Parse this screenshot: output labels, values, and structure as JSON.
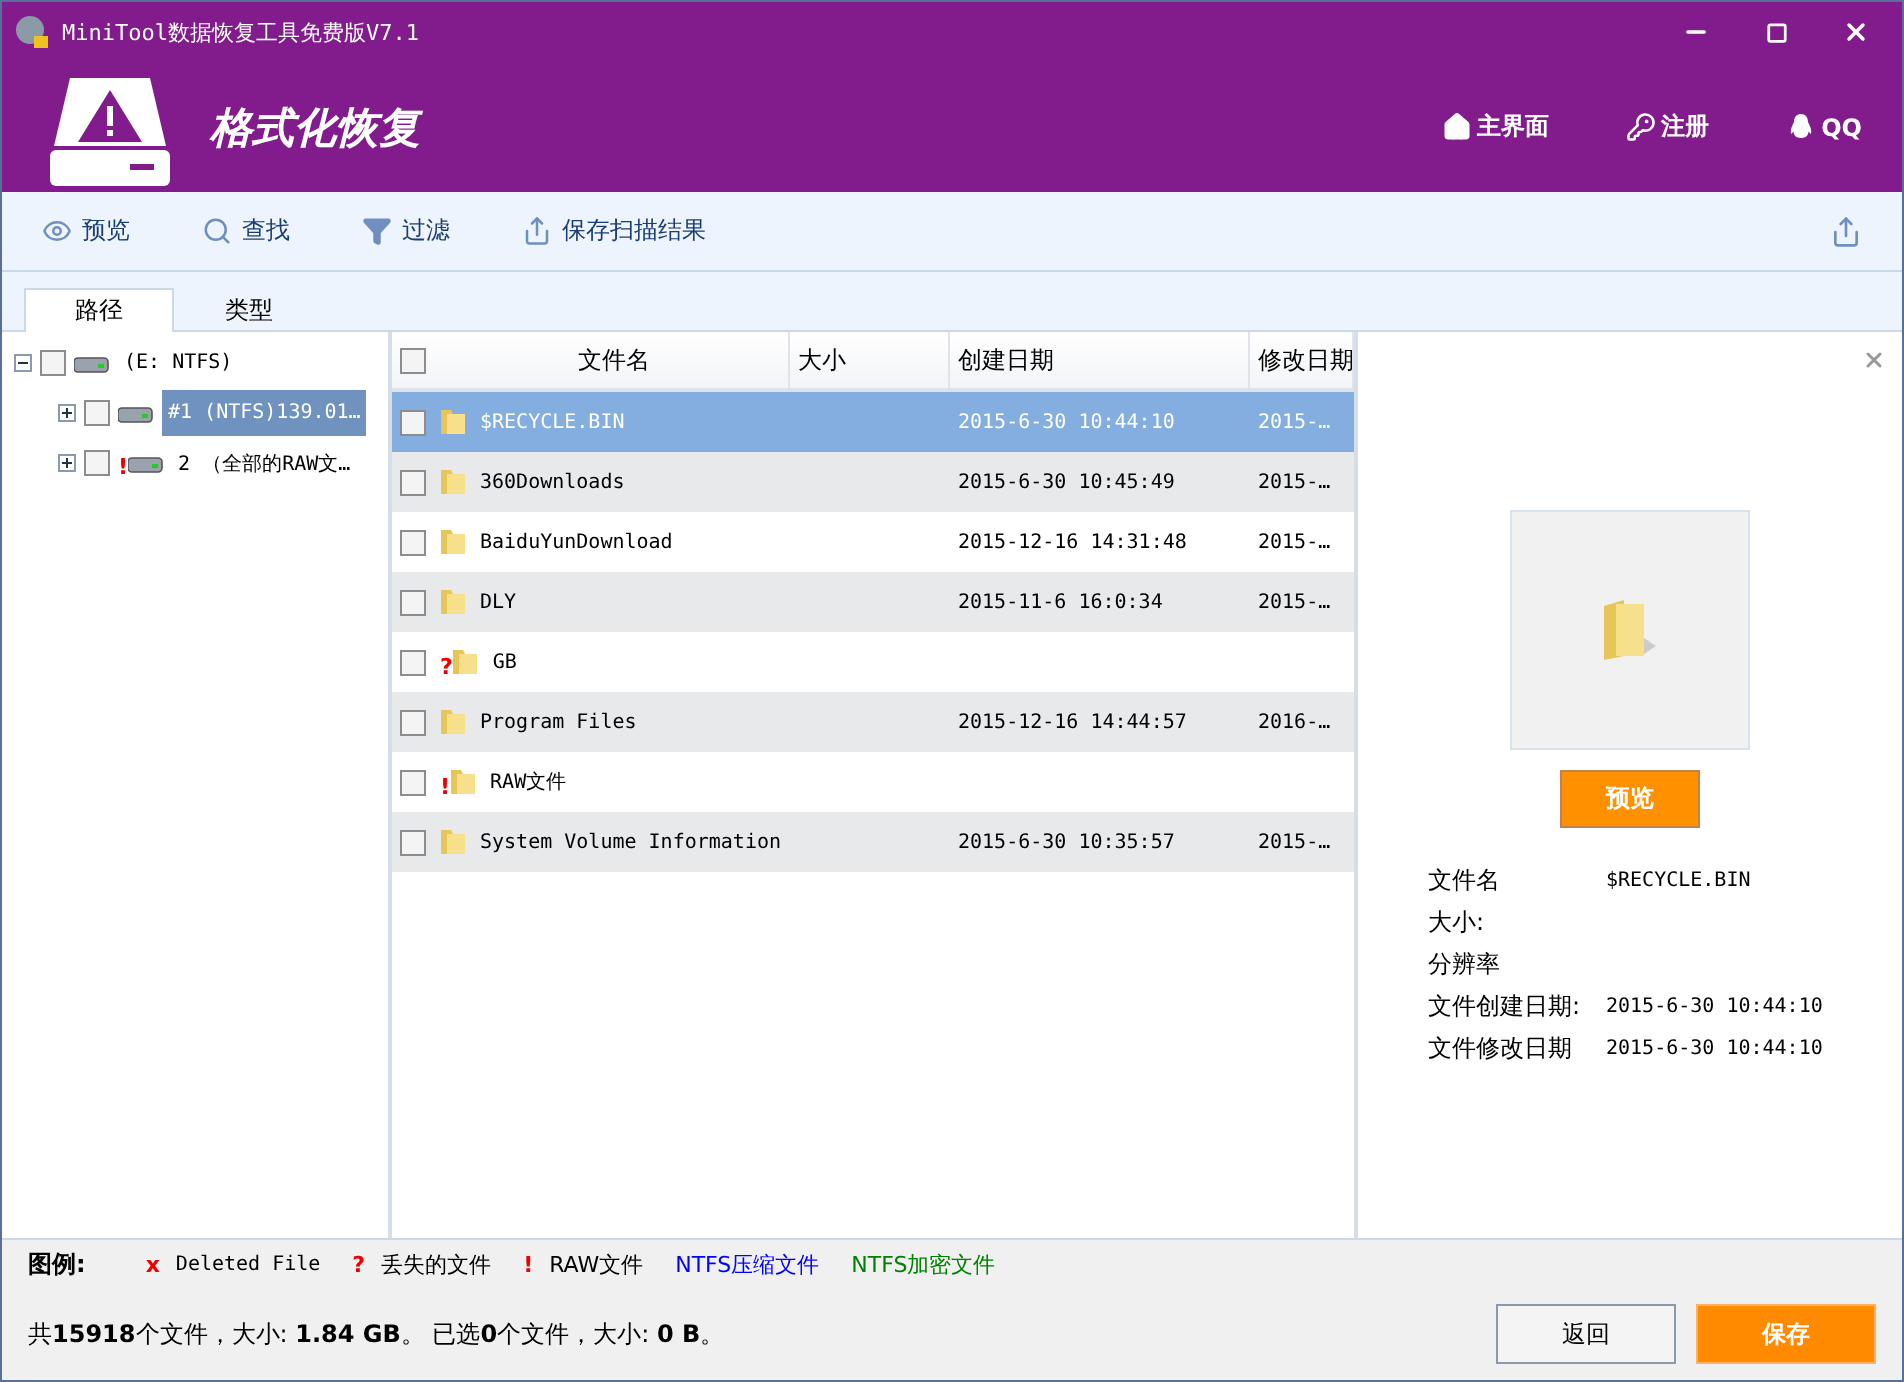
{
  "window": {
    "title": "MiniTool数据恢复工具免费版V7.1"
  },
  "header": {
    "title": "格式化恢复",
    "nav": [
      {
        "label": "主界面",
        "kind": "home"
      },
      {
        "label": "注册",
        "kind": "key"
      },
      {
        "label": "QQ",
        "kind": "qq"
      }
    ]
  },
  "toolbar": {
    "items": [
      {
        "label": "预览",
        "kind": "eye"
      },
      {
        "label": "查找",
        "kind": "search"
      },
      {
        "label": "过滤",
        "kind": "filter"
      },
      {
        "label": "保存扫描结果",
        "kind": "export"
      }
    ]
  },
  "tabs": [
    {
      "label": "路径",
      "selected": true
    },
    {
      "label": "类型",
      "selected": false
    }
  ],
  "tree": [
    {
      "label": "(E: NTFS)",
      "checked": false,
      "expanded": true,
      "selected": false,
      "children": [
        {
          "label": "#1 (NTFS)139.01…",
          "checked": false,
          "expanded": false,
          "selected": true
        },
        {
          "label": "2 （全部的RAW文…",
          "checked": false,
          "expanded": false,
          "selected": false,
          "mark": "!"
        }
      ]
    }
  ],
  "table": {
    "select_all_checked": false,
    "columns": [
      "文件名",
      "大小",
      "创建日期",
      "修改日期"
    ],
    "rows": [
      {
        "name": "$RECYCLE.BIN",
        "created": "2015-6-30 10:44:10",
        "modified": "2015-…",
        "checked": false,
        "selected": true
      },
      {
        "name": "360Downloads",
        "created": "2015-6-30 10:45:49",
        "modified": "2015-…",
        "checked": false,
        "selected": false
      },
      {
        "name": "BaiduYunDownload",
        "created": "2015-12-16 14:31:48",
        "modified": "2015-…",
        "checked": false,
        "selected": false
      },
      {
        "name": "DLY",
        "created": "2015-11-6 16:0:34",
        "modified": "2015-…",
        "checked": false,
        "selected": false
      },
      {
        "name": "GB",
        "checked": false,
        "selected": false,
        "mark": "?"
      },
      {
        "name": "Program Files",
        "created": "2015-12-16 14:44:57",
        "modified": "2016-…",
        "checked": false,
        "selected": false
      },
      {
        "name": "RAW文件",
        "checked": false,
        "selected": false,
        "mark": "!"
      },
      {
        "name": "System Volume Information",
        "created": "2015-6-30 10:35:57",
        "modified": "2015-…",
        "checked": false,
        "selected": false
      }
    ]
  },
  "preview": {
    "button": "预览",
    "fields": [
      {
        "label": "文件名",
        "value": "$RECYCLE.BIN"
      },
      {
        "label": "大小:"
      },
      {
        "label": "分辨率"
      },
      {
        "label": "文件创建日期:",
        "value": "2015-6-30 10:44:10"
      },
      {
        "label": "文件修改日期",
        "value": "2015-6-30 10:44:10"
      }
    ]
  },
  "legend": {
    "title": "图例:",
    "items": [
      {
        "mark": "x",
        "label": "Deleted File",
        "color": "#000000"
      },
      {
        "mark": "?",
        "label": "丢失的文件",
        "color": "#000000"
      },
      {
        "mark": "!",
        "label": "RAW文件",
        "color": "#000000"
      },
      {
        "label": "NTFS压缩文件",
        "color": "#0000ff"
      },
      {
        "label": "NTFS加密文件",
        "color": "#008000"
      }
    ]
  },
  "status": "共**15918**个文件，大小: **1.84 GB**。 已选**0**个文件，大小: **0 B**。",
  "buttons": [
    {
      "label": "返回",
      "kind": "secondary"
    },
    {
      "label": "保存",
      "kind": "primary"
    }
  ]
}
